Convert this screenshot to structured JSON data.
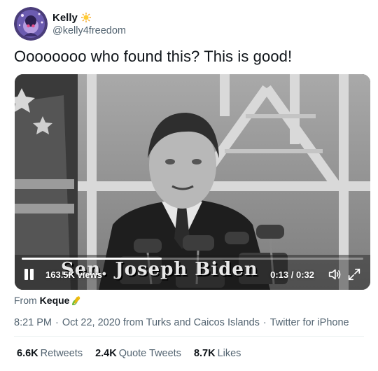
{
  "user": {
    "name": "Kelly",
    "handle": "@kelly4freedom",
    "badge_icon": "sun-emoji-icon",
    "avatar_icon": "avatar-icon"
  },
  "tweet": {
    "text": "Oooooooo who found this? This is good!"
  },
  "video": {
    "views": "163.5K views",
    "time": "0:13 / 0:32",
    "progress": 0.41,
    "caption": "Sen. Joseph Biden",
    "controls": [
      "pause-icon",
      "volume-icon",
      "fullscreen-icon"
    ]
  },
  "source": {
    "prefix": "From",
    "name": "Keque",
    "badge_icon": "corn-emoji-icon"
  },
  "meta": {
    "time": "8:21 PM",
    "date": "Oct 22, 2020",
    "location": "from Turks and Caicos Islands",
    "client": "Twitter for iPhone",
    "separator": "·"
  },
  "stats": [
    {
      "count": "6.6K",
      "label": "Retweets"
    },
    {
      "count": "2.4K",
      "label": "Quote Tweets"
    },
    {
      "count": "8.7K",
      "label": "Likes"
    }
  ],
  "colors": {
    "text": "#0f1419",
    "secondary": "#536471",
    "divider": "#eff3f4"
  }
}
